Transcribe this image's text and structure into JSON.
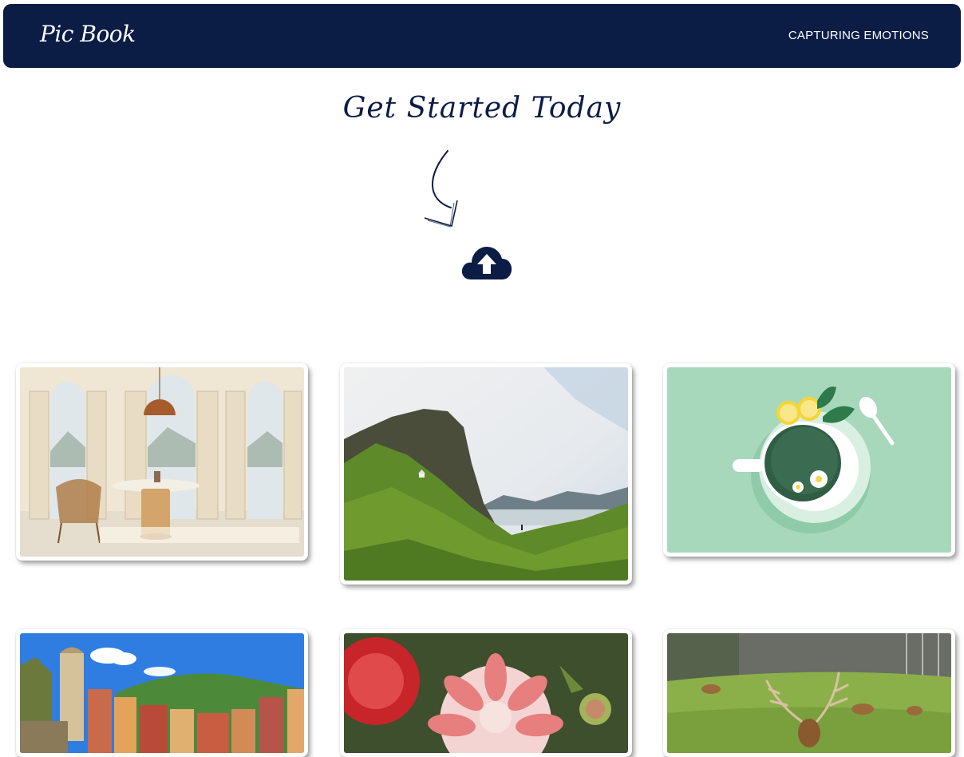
{
  "navbar": {
    "logo": "Pic Book",
    "tagline": "CAPTURING EMOTIONS"
  },
  "hero": {
    "title": "Get Started Today"
  },
  "icons": {
    "arrow": "curved-arrow-down-icon",
    "upload": "cloud-upload-icon"
  },
  "colors": {
    "navy": "#0b1c45",
    "white": "#ffffff"
  },
  "gallery": {
    "photos": [
      "interior-room-photo",
      "green-cliff-landscape-photo",
      "green-tea-illustration",
      "coastal-village-photo",
      "dahlia-flower-photo",
      "deer-meadow-photo"
    ]
  }
}
